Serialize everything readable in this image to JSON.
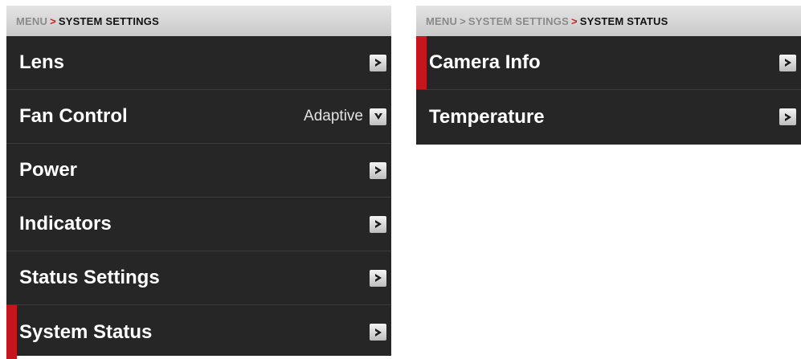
{
  "colors": {
    "panel_bg": "#262626",
    "header_bg": "#d6d6d6",
    "accent_red": "#c4161c",
    "text_white": "#ffffff"
  },
  "left_panel": {
    "breadcrumb": {
      "root": "MENU",
      "separator": ">",
      "current": "SYSTEM SETTINGS"
    },
    "items": [
      {
        "label": "Lens",
        "value": "",
        "control": "chevron-right-icon",
        "selected": false
      },
      {
        "label": "Fan Control",
        "value": "Adaptive",
        "control": "chevron-down-icon",
        "selected": false
      },
      {
        "label": "Power",
        "value": "",
        "control": "chevron-right-icon",
        "selected": false
      },
      {
        "label": "Indicators",
        "value": "",
        "control": "chevron-right-icon",
        "selected": false
      },
      {
        "label": "Status Settings",
        "value": "",
        "control": "chevron-right-icon",
        "selected": false
      },
      {
        "label": "System Status",
        "value": "",
        "control": "chevron-right-icon",
        "selected": true
      }
    ]
  },
  "right_panel": {
    "breadcrumb": {
      "root": "MENU",
      "separator1": ">",
      "middle": "SYSTEM SETTINGS",
      "separator2": ">",
      "current": "SYSTEM STATUS"
    },
    "items": [
      {
        "label": "Camera Info",
        "control": "chevron-right-icon",
        "selected": true
      },
      {
        "label": "Temperature",
        "control": "chevron-right-icon",
        "selected": false
      }
    ]
  }
}
